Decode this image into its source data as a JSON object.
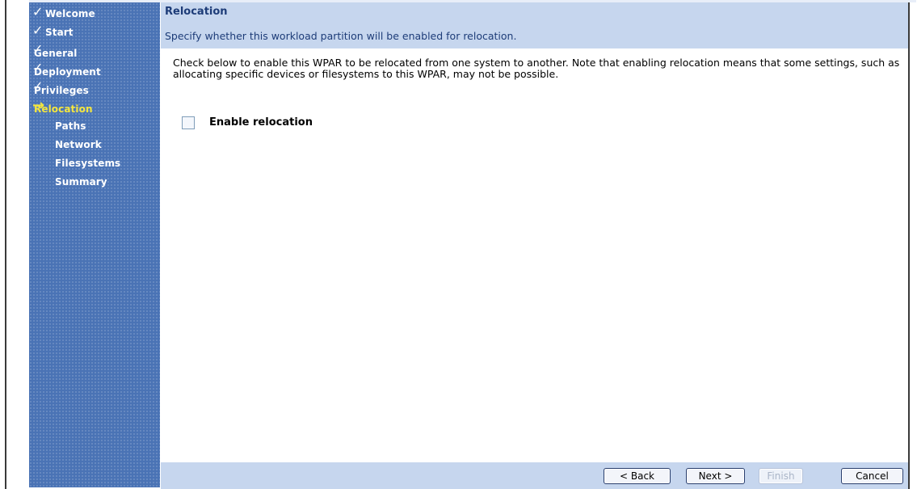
{
  "sidebar": {
    "items": [
      {
        "label": "Welcome",
        "state": "done",
        "icon": "checkmark-icon"
      },
      {
        "label": "Start",
        "state": "done",
        "icon": "checkmark-icon"
      },
      {
        "label": "General",
        "state": "done",
        "icon": "checkmark-icon"
      },
      {
        "label": "Deployment",
        "state": "done",
        "icon": "checkmark-icon"
      },
      {
        "label": "Privileges",
        "state": "done",
        "icon": "checkmark-icon"
      },
      {
        "label": "Relocation",
        "state": "current",
        "icon": "arrow-right-icon"
      },
      {
        "label": "Paths",
        "state": "pending"
      },
      {
        "label": "Network",
        "state": "pending"
      },
      {
        "label": "Filesystems",
        "state": "pending"
      },
      {
        "label": "Summary",
        "state": "pending"
      }
    ],
    "check_glyph": "✓",
    "arrow_glyph": "→",
    "current_color": "#f4e63e"
  },
  "header": {
    "title": "Relocation",
    "subtitle": "Specify whether this workload partition will be enabled for relocation."
  },
  "main": {
    "description": "Check below to enable this WPAR to be relocated from one system to another. Note that enabling relocation means that some settings, such as allocating specific devices or filesystems to this WPAR, may not be possible.",
    "enable_relocation": {
      "label": "Enable relocation",
      "checked": false
    }
  },
  "footer": {
    "back_label": "< Back",
    "next_label": "Next >",
    "finish_label": "Finish",
    "finish_enabled": false,
    "cancel_label": "Cancel"
  },
  "colors": {
    "sidebar_bg": "#4a73b5",
    "header_bg": "#c6d6ee",
    "title_text": "#1d3c78"
  }
}
